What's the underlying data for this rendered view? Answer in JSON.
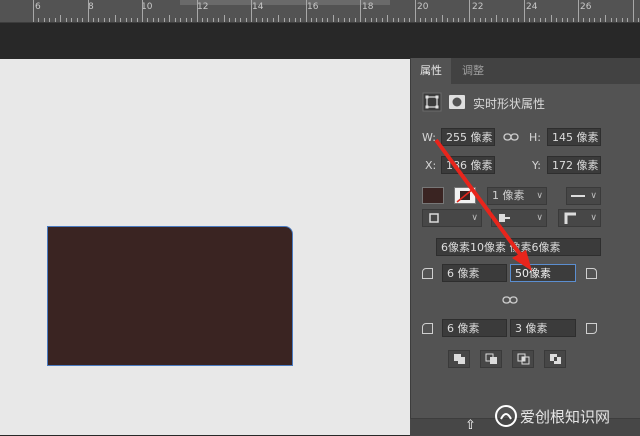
{
  "ruler": {
    "labels": [
      "6",
      "8",
      "10",
      "12",
      "14",
      "16",
      "18",
      "20",
      "22",
      "24",
      "26"
    ]
  },
  "panel": {
    "tabs": [
      {
        "label": "属性",
        "active": true
      },
      {
        "label": "调整",
        "active": false
      }
    ],
    "section_title": "实时形状属性",
    "w": {
      "label": "W:",
      "value": "255 像素"
    },
    "h": {
      "label": "H:",
      "value": "145 像素"
    },
    "x": {
      "label": "X:",
      "value": "186 像素"
    },
    "y": {
      "label": "Y:",
      "value": "172 像素"
    },
    "fill_color": "#3a2422",
    "stroke_width": "1 像素",
    "radius_combined": "6像素10像素 像素6像素",
    "radius_tl": "6 像素",
    "radius_tr": "50像素",
    "radius_bl": "6 像素",
    "radius_br": "3 像素"
  },
  "colors": {
    "accent": "#5b8ed0",
    "arrow": "#e8251c"
  },
  "watermark": "爱创根知识网"
}
